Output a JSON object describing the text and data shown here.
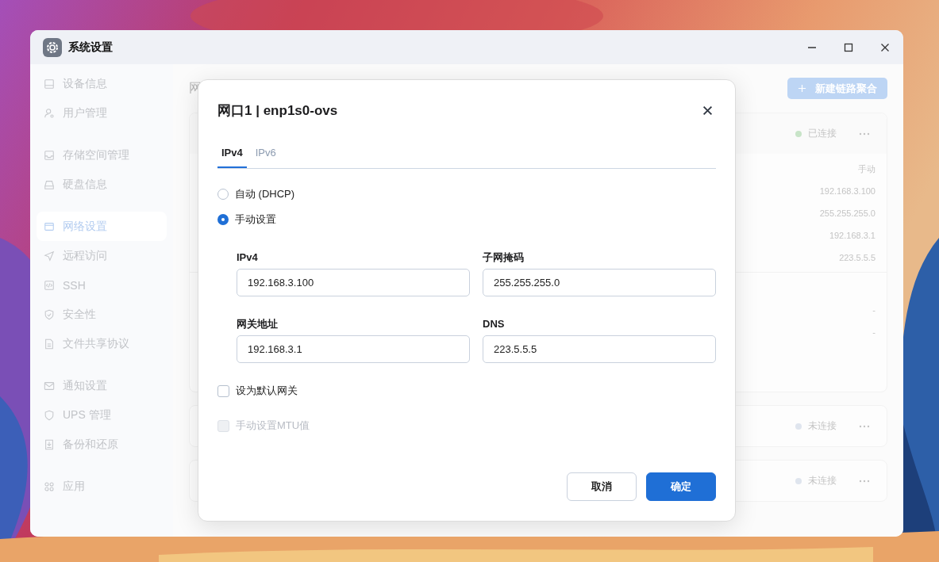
{
  "window": {
    "title": "系统设置"
  },
  "sidebar": {
    "groups": [
      [
        {
          "label": "设备信息",
          "selected": false
        },
        {
          "label": "用户管理",
          "selected": false
        }
      ],
      [
        {
          "label": "存储空间管理",
          "selected": false
        },
        {
          "label": "硬盘信息",
          "selected": false
        }
      ],
      [
        {
          "label": "网络设置",
          "selected": true
        },
        {
          "label": "远程访问",
          "selected": false
        },
        {
          "label": "SSH",
          "selected": false
        },
        {
          "label": "安全性",
          "selected": false
        },
        {
          "label": "文件共享协议",
          "selected": false
        }
      ],
      [
        {
          "label": "通知设置",
          "selected": false
        },
        {
          "label": "UPS 管理",
          "selected": false
        },
        {
          "label": "备份和还原",
          "selected": false
        }
      ],
      [
        {
          "label": "应用",
          "selected": false
        }
      ]
    ]
  },
  "page": {
    "heading": "网",
    "new_button": "新建链路聚合",
    "cards": [
      {
        "status": "已连接",
        "color": "#c8e4c8",
        "values": [
          "手动",
          "192.168.3.100",
          "255.255.255.0",
          "192.168.3.1",
          "223.5.5.5"
        ],
        "extra_values": [
          "-",
          "-"
        ]
      },
      {
        "status": "未连接",
        "color": "#dfe5ee"
      },
      {
        "status": "未连接",
        "color": "#dfe5ee"
      }
    ]
  },
  "dialog": {
    "title": "网口1 | enp1s0-ovs",
    "tabs": [
      {
        "label": "IPv4",
        "selected": true
      },
      {
        "label": "IPv6",
        "selected": false
      }
    ],
    "modes": [
      {
        "label": "自动 (DHCP)",
        "selected": false
      },
      {
        "label": "手动设置",
        "selected": true
      }
    ],
    "fields": [
      {
        "label": "IPv4",
        "value": "192.168.3.100"
      },
      {
        "label": "子网掩码",
        "value": "255.255.255.0"
      },
      {
        "label": "网关地址",
        "value": "192.168.3.1"
      },
      {
        "label": "DNS",
        "value": "223.5.5.5"
      }
    ],
    "options": [
      {
        "label": "设为默认网关",
        "checked": false,
        "disabled": false
      },
      {
        "label": "手动设置MTU值",
        "checked": false,
        "disabled": true
      }
    ],
    "buttons": [
      {
        "label": "取消",
        "kind": "secondary"
      },
      {
        "label": "确定",
        "kind": "primary"
      }
    ]
  }
}
